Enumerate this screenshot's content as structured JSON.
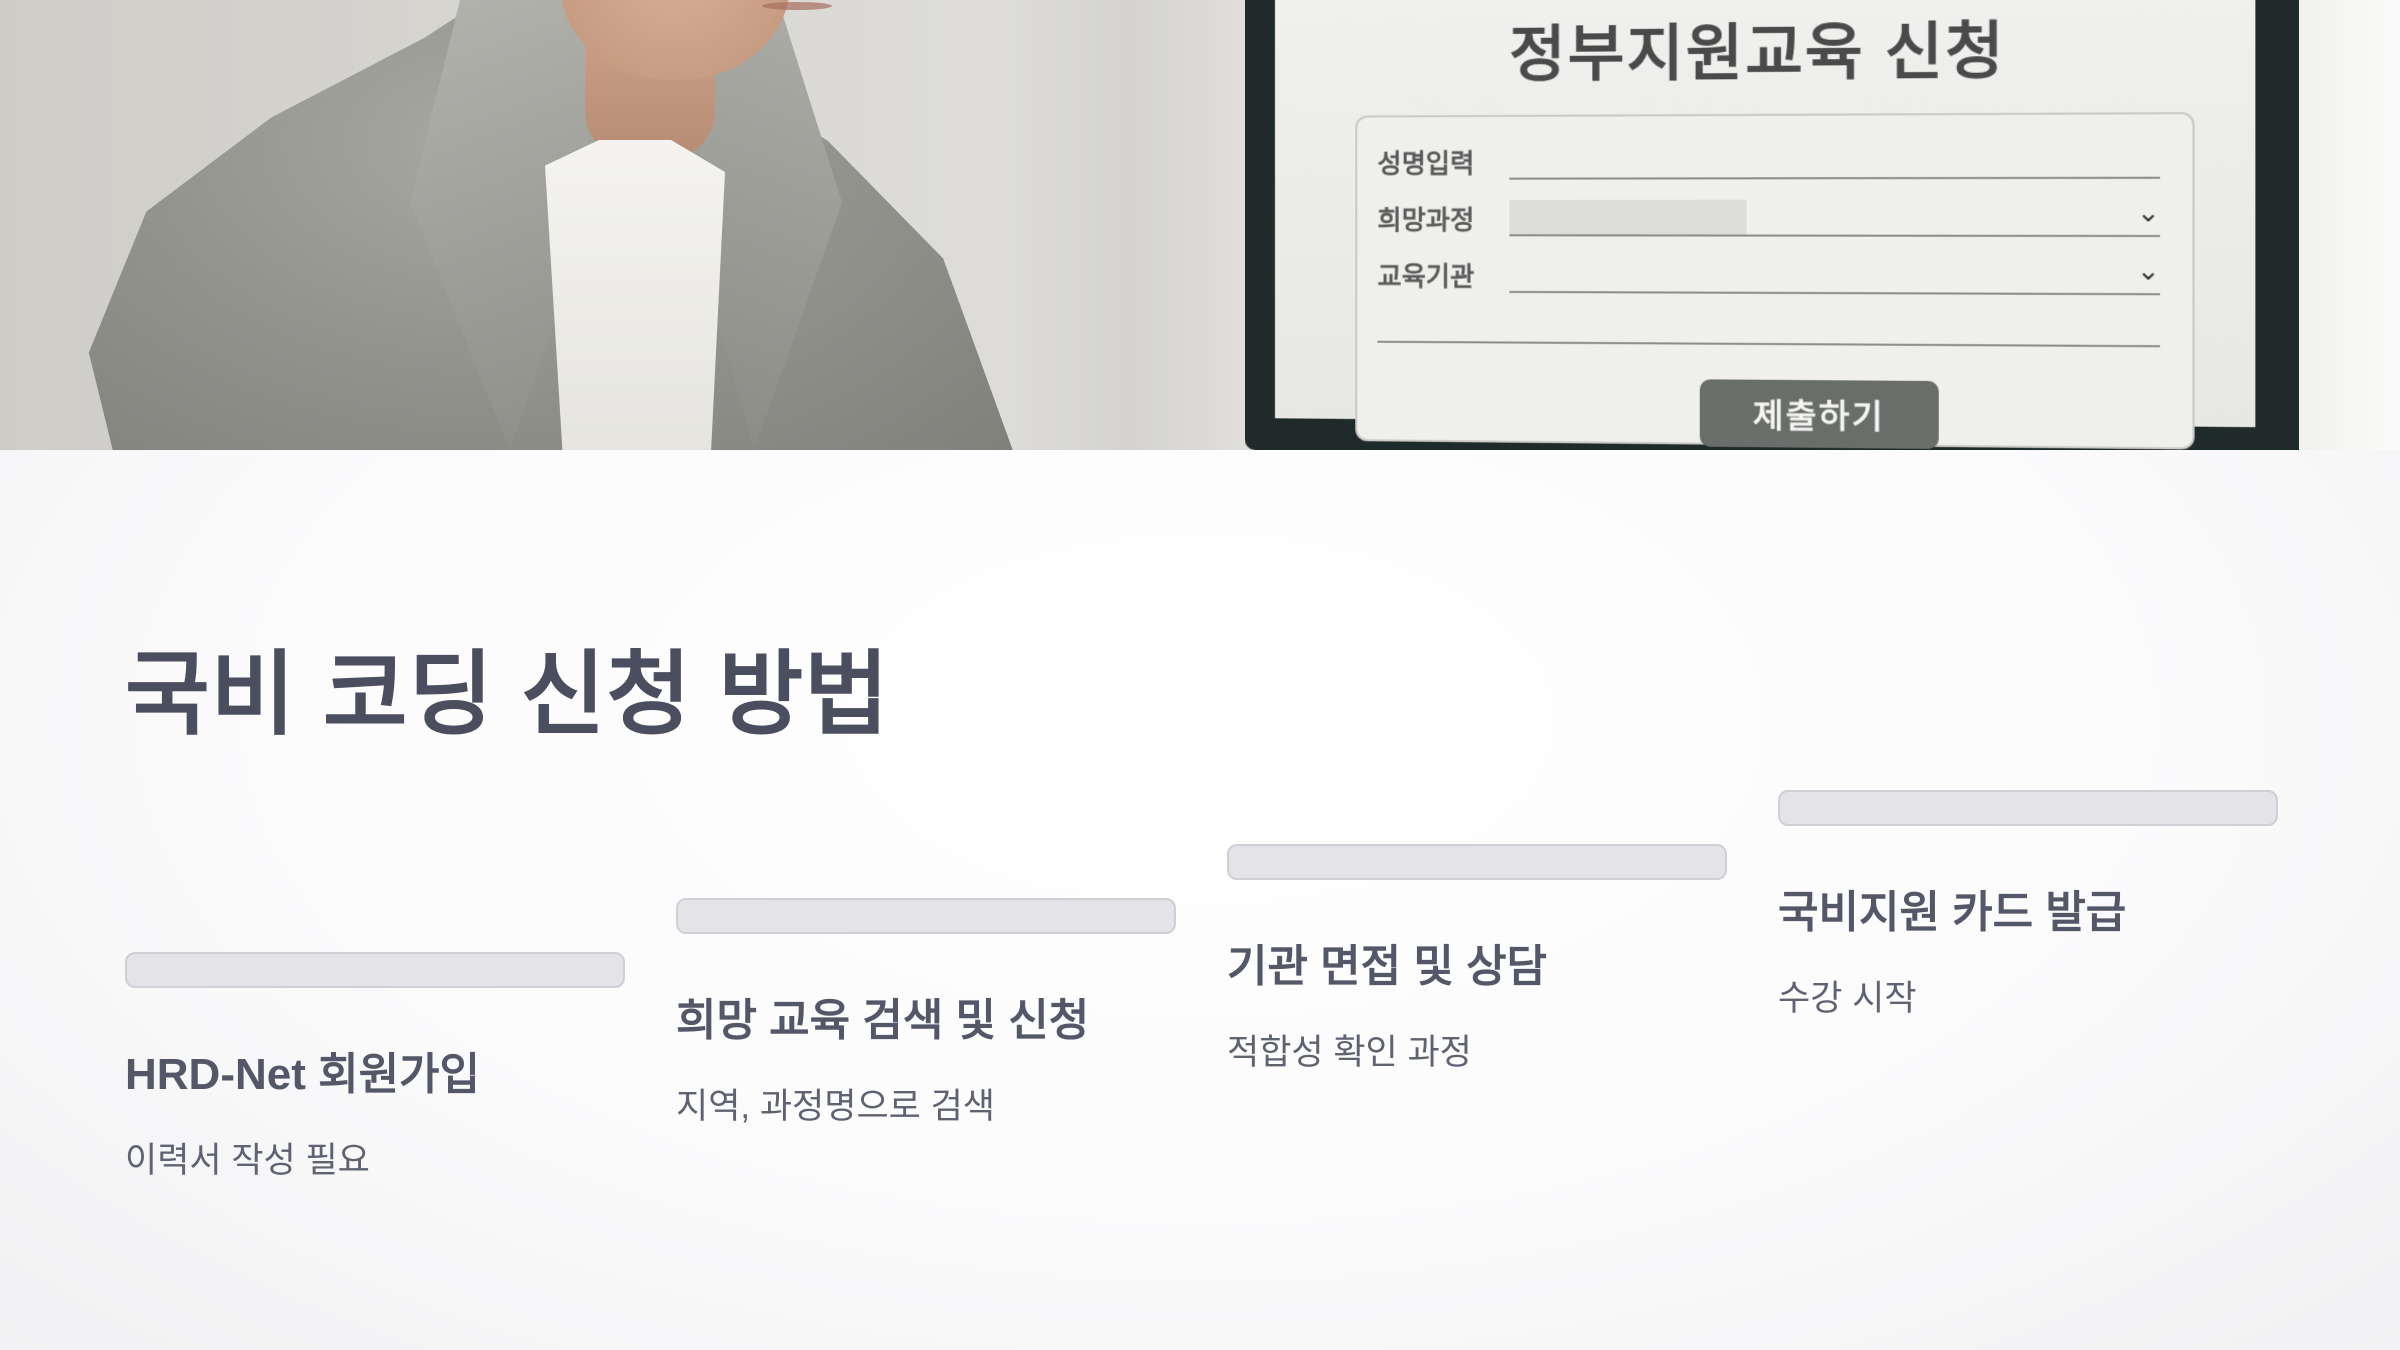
{
  "hero": {
    "screen_title": "정부지원교육 신청",
    "form_rows": [
      {
        "label": "성명입력",
        "has_fill": false,
        "has_chevron": false
      },
      {
        "label": "희망과정",
        "has_fill": true,
        "has_chevron": true
      },
      {
        "label": "교육기관",
        "has_fill": false,
        "has_chevron": true
      }
    ],
    "submit_label": "제출하기"
  },
  "page": {
    "title": "국비 코딩 신청 방법"
  },
  "steps": [
    {
      "title": "HRD-Net 회원가입",
      "desc": "이력서 작성 필요"
    },
    {
      "title": "희망 교육 검색 및 신청",
      "desc": "지역, 과정명으로 검색"
    },
    {
      "title": "기관 면접 및 상담",
      "desc": "적합성 확인 과정"
    },
    {
      "title": "국비지원 카드 발급",
      "desc": "수강 시작"
    }
  ],
  "colors": {
    "title": "#4b4e5f",
    "step_title": "#545767",
    "step_desc": "#5f6270",
    "step_bar": "#e3e3e8"
  }
}
